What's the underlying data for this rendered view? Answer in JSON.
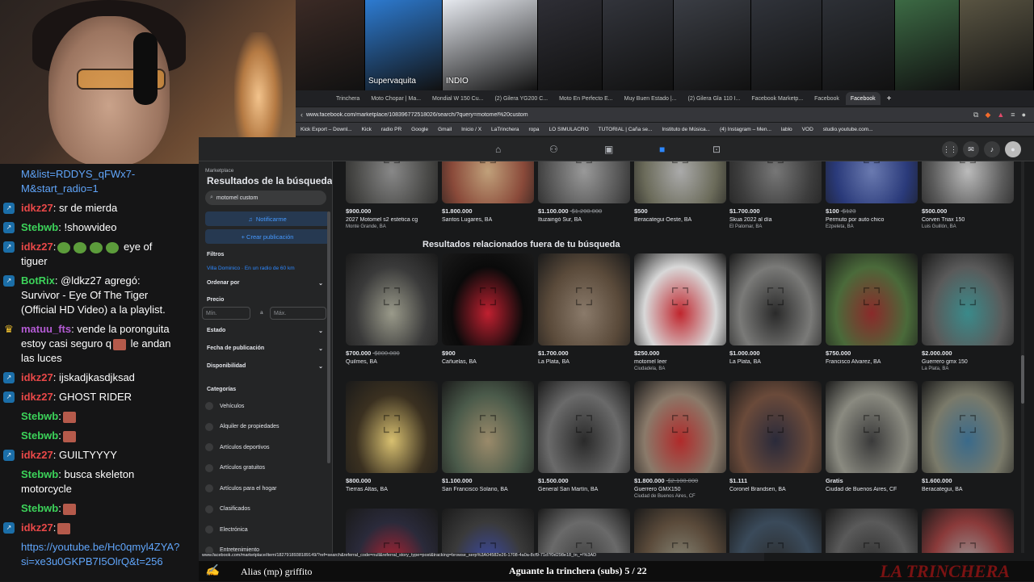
{
  "webcam": {},
  "thumbnails": [
    {
      "w": 86,
      "color": "#3b2a25",
      "label": ""
    },
    {
      "w": 96,
      "color": "#2d7bd1",
      "label": "Supervaquita"
    },
    {
      "w": 118,
      "color": "#e6e9ef",
      "label": "INDIO"
    },
    {
      "w": 80,
      "color": "#2e2e35",
      "label": ""
    },
    {
      "w": 88,
      "color": "#32343b",
      "label": ""
    },
    {
      "w": 96,
      "color": "#3a3d44",
      "label": ""
    },
    {
      "w": 88,
      "color": "#30333a",
      "label": ""
    },
    {
      "w": 90,
      "color": "#2d3036",
      "label": ""
    },
    {
      "w": 80,
      "color": "#3c6a44",
      "label": ""
    },
    {
      "w": 92,
      "color": "#595442",
      "label": ""
    }
  ],
  "tabs": [
    "Trinchera",
    "Moto Chopar | Ma...",
    "Mondial W 150 Cu...",
    "(2) Gilera YG200 C...",
    "Moto En Perfecto E...",
    "Muy Buen Estado |...",
    "(2) Gilera Gla 110 I...",
    "Facebook Marketp...",
    "Facebook",
    "Facebook"
  ],
  "active_tab_index": 9,
  "url": "www.facebook.com/marketplace/108396772518026/search/?query=motomel%20custom",
  "bookmarks": [
    "Kick Export – Downl...",
    "Kick",
    "radio PR",
    "Google",
    "Gmail",
    "Inicio / X",
    "LaTrinchera",
    "ropa",
    "LO SIMULACRO",
    "TUTORIAL | Caña se...",
    "Instituto de Música...",
    "(4) Instagram – Men...",
    "lablo",
    "VOD",
    "studio.youtube.com..."
  ],
  "sidebar": {
    "marketplace": "Marketplace",
    "title": "Resultados de la búsqueda",
    "search_value": "motomel custom",
    "notify_btn": "Notificarme",
    "create_btn": "+ Crear publicación",
    "filters": "Filtros",
    "location": "Villa Dominico · En un radio de 60 km",
    "sort": "Ordenar por",
    "price": "Precio",
    "min": "Mín.",
    "to": "a",
    "max": "Máx.",
    "condition": "Estado",
    "date": "Fecha de publicación",
    "availability": "Disponibilidad",
    "categories": "Categorías",
    "cat_items": [
      "Vehículos",
      "Alquiler de propiedades",
      "Artículos deportivos",
      "Artículos gratuitos",
      "Artículos para el hogar",
      "Clasificados",
      "Electrónica",
      "Entretenimiento"
    ]
  },
  "related_heading": "Resultados relacionados fuera de tu búsqueda",
  "row1": [
    {
      "price": "$900.000",
      "old": "",
      "title": "2027 Motomel s2 estetica cg",
      "loc": "Monte Grande, BA",
      "c1": "#4a4a48",
      "c2": "#888"
    },
    {
      "price": "$1.800.000",
      "old": "",
      "title": "Santos Lugares, BA",
      "loc": "",
      "c1": "#8a4a3a",
      "c2": "#c0a07a"
    },
    {
      "price": "$1.100.000",
      "old": "$1.200.000",
      "title": "Ituzaingó Sur, BA",
      "loc": "",
      "c1": "#555",
      "c2": "#999"
    },
    {
      "price": "$500",
      "old": "",
      "title": "Beracategui Oeste, BA",
      "loc": "",
      "c1": "#6b6b5a",
      "c2": "#aaa"
    },
    {
      "price": "$1.700.000",
      "old": "",
      "title": "Skua 2022 al día",
      "loc": "El Palomar, BA",
      "c1": "#3d3d3d",
      "c2": "#777"
    },
    {
      "price": "$100",
      "old": "$123",
      "title": "Permuto por auto chico",
      "loc": "Ezpeleta, BA",
      "c1": "#2a3a7a",
      "c2": "#6a7ab0"
    },
    {
      "price": "$500.000",
      "old": "",
      "title": "Corven Triax 150",
      "loc": "Luis Guillón, BA",
      "c1": "#5a5a5a",
      "c2": "#bbb"
    }
  ],
  "row2": [
    {
      "price": "$700.000",
      "old": "$800.000",
      "title": "Quilmes, BA",
      "loc": "",
      "c1": "#3a3a3a",
      "c2": "#9a9a8a"
    },
    {
      "price": "$900",
      "old": "",
      "title": "Cañuelas, BA",
      "loc": "",
      "c1": "#0a0a0a",
      "c2": "#c02030"
    },
    {
      "price": "$1.700.000",
      "old": "",
      "title": "La Plata, BA",
      "loc": "",
      "c1": "#5a4a3a",
      "c2": "#8a7a6a"
    },
    {
      "price": "$250.000",
      "old": "",
      "title": "motomel leer",
      "loc": "Ciudadela, BA",
      "c1": "#d8d8d8",
      "c2": "#c0262e"
    },
    {
      "price": "$1.000.000",
      "old": "",
      "title": "La Plata, BA",
      "loc": "",
      "c1": "#7a7a78",
      "c2": "#2a2a2a"
    },
    {
      "price": "$750.000",
      "old": "",
      "title": "Francisco Alvarez, BA",
      "loc": "",
      "c1": "#4a6a3a",
      "c2": "#8a2a2a"
    },
    {
      "price": "$2.000.000",
      "old": "",
      "title": "Guerrero gmx 150",
      "loc": "La Plata, BA",
      "c1": "#5a5a5a",
      "c2": "#3a8a8a"
    }
  ],
  "row3": [
    {
      "price": "$800.000",
      "old": "",
      "title": "Tierras Altas, BA",
      "loc": "",
      "c1": "#3a3020",
      "c2": "#d8c070"
    },
    {
      "price": "$1.100.000",
      "old": "",
      "title": "San Francisco Solano, BA",
      "loc": "",
      "c1": "#4a5a4a",
      "c2": "#9a8a6a"
    },
    {
      "price": "$1.500.000",
      "old": "",
      "title": "General San Martín, BA",
      "loc": "",
      "c1": "#6a6a6a",
      "c2": "#2a2a2a"
    },
    {
      "price": "$1.800.000",
      "old": "$2.100.000",
      "title": "Guerrero GMX150",
      "loc": "Ciudad de Buenos Aires, CF",
      "c1": "#8a7a6a",
      "c2": "#b02a2a"
    },
    {
      "price": "$1.111",
      "old": "",
      "title": "Coronel Brandsen, BA",
      "loc": "",
      "c1": "#6a4a3a",
      "c2": "#2a2a3a"
    },
    {
      "price": "Gratis",
      "old": "",
      "title": "Ciudad de Buenos Aires, CF",
      "loc": "",
      "c1": "#8a8a80",
      "c2": "#3a3a3a"
    },
    {
      "price": "$1.600.000",
      "old": "",
      "title": "Beracategui, BA",
      "loc": "",
      "c1": "#7a7a6a",
      "c2": "#3a6a8a"
    }
  ],
  "row4": [
    {
      "c1": "#2a2a3a",
      "c2": "#c02030"
    },
    {
      "c1": "#3a3a3a",
      "c2": "#3a4ab0"
    },
    {
      "c1": "#6a6a6a",
      "c2": "#3a3a3a"
    },
    {
      "c1": "#5a4a3a",
      "c2": "#8a8a7a"
    },
    {
      "c1": "#3a4a5a",
      "c2": "#2a2a2a"
    },
    {
      "c1": "#5a5a5a",
      "c2": "#2a2a2a"
    },
    {
      "c1": "#8a3a3a",
      "c2": "#9a9a9a"
    }
  ],
  "status_url": "www.facebook.com/marketplace/item/1827918938189149/?ref=search&referral_code=null&referral_story_type=post&tracking=browse_serp%3A04582e26-1708-4a0a-8cf9-71d7f0d298e18_tn_=!%3AD",
  "chat": [
    {
      "badge": "",
      "user": "",
      "text": "M&amp;list=RDDYS_qFWx7-M&amp;start_radio=1",
      "link": true
    },
    {
      "badge": "k",
      "user": "idkz27",
      "ucolor": "#e94848",
      "text": ": sr de mierda"
    },
    {
      "badge": "k",
      "user": "Stebwb",
      "ucolor": "#3cd35a",
      "text": ": !showvideo"
    },
    {
      "badge": "k",
      "user": "idkz27",
      "ucolor": "#e94848",
      "text": ":",
      "emotes": "green4",
      "tail": "eye of tiguer"
    },
    {
      "badge": "k",
      "user": "BotRix",
      "ucolor": "#3cd35a",
      "text": ": @ldkz27 agregó: Survivor - Eye Of The Tiger (Official HD Video) a la playlist."
    },
    {
      "badge": "crown",
      "user": "matuu_fts",
      "ucolor": "#b45bd4",
      "text": ": vende la poronguita estoy casi seguro q",
      "emotes": "one",
      "tail": "le andan las luces"
    },
    {
      "badge": "k",
      "user": "idkz27",
      "ucolor": "#e94848",
      "text": ": ijskadjkasdjksad"
    },
    {
      "badge": "k",
      "user": "idkz27",
      "ucolor": "#e94848",
      "text": ": GHOST RIDER"
    },
    {
      "badge": "",
      "user": "Stebwb",
      "ucolor": "#3cd35a",
      "text": ":",
      "emotes": "one"
    },
    {
      "badge": "",
      "user": "Stebwb",
      "ucolor": "#3cd35a",
      "text": ":",
      "emotes": "one"
    },
    {
      "badge": "k",
      "user": "idkz27",
      "ucolor": "#e94848",
      "text": ": GUILTYYYY"
    },
    {
      "badge": "",
      "user": "Stebwb",
      "ucolor": "#3cd35a",
      "text": ": busca skeleton motorcycle"
    },
    {
      "badge": "",
      "user": "Stebwb",
      "ucolor": "#3cd35a",
      "text": ":",
      "emotes": "one"
    },
    {
      "badge": "k",
      "user": "idkz27",
      "ucolor": "#e94848",
      "text": ":",
      "emotes": "one"
    },
    {
      "badge": "",
      "user": "",
      "text": "https://youtube.be/Hc0qmyl4ZYA?si=xe3u0GKPB7I5OlrQ&amp;t=256",
      "link": true
    }
  ],
  "ticker": {
    "alias": "Alias (mp) griffito",
    "subs": "Aguante la trinchera (subs) 5 / 22",
    "brand": "LA TRINCHERA"
  }
}
